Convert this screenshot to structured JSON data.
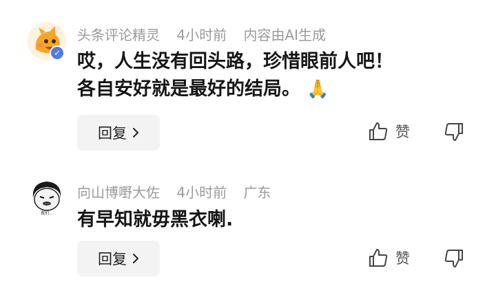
{
  "comments": [
    {
      "author": "头条评论精灵",
      "time": "4小时前",
      "extra": "内容由AI生成",
      "text_line1": "哎，人生没有回头路，珍惜眼前人吧！",
      "text_line2": "各自安好就是最好的结局。",
      "emoji": "🙏",
      "reply_label": "回复",
      "like_label": "赞",
      "verified": true
    },
    {
      "author": "向山博嘢大佐",
      "time": "4小时前",
      "extra": "广东",
      "text_line1": "有早知就毋黑衣喇.",
      "reply_label": "回复",
      "like_label": "赞",
      "verified": false
    }
  ],
  "icons": {
    "reply_chevron": "chevron-right-icon",
    "like": "thumb-up-icon",
    "dislike": "thumb-down-icon",
    "verified": "verified-badge-icon"
  },
  "colors": {
    "meta": "#9a9a9a",
    "text": "#161616",
    "reply_bg": "#f3f3f3",
    "verified": "#4e7de0"
  }
}
